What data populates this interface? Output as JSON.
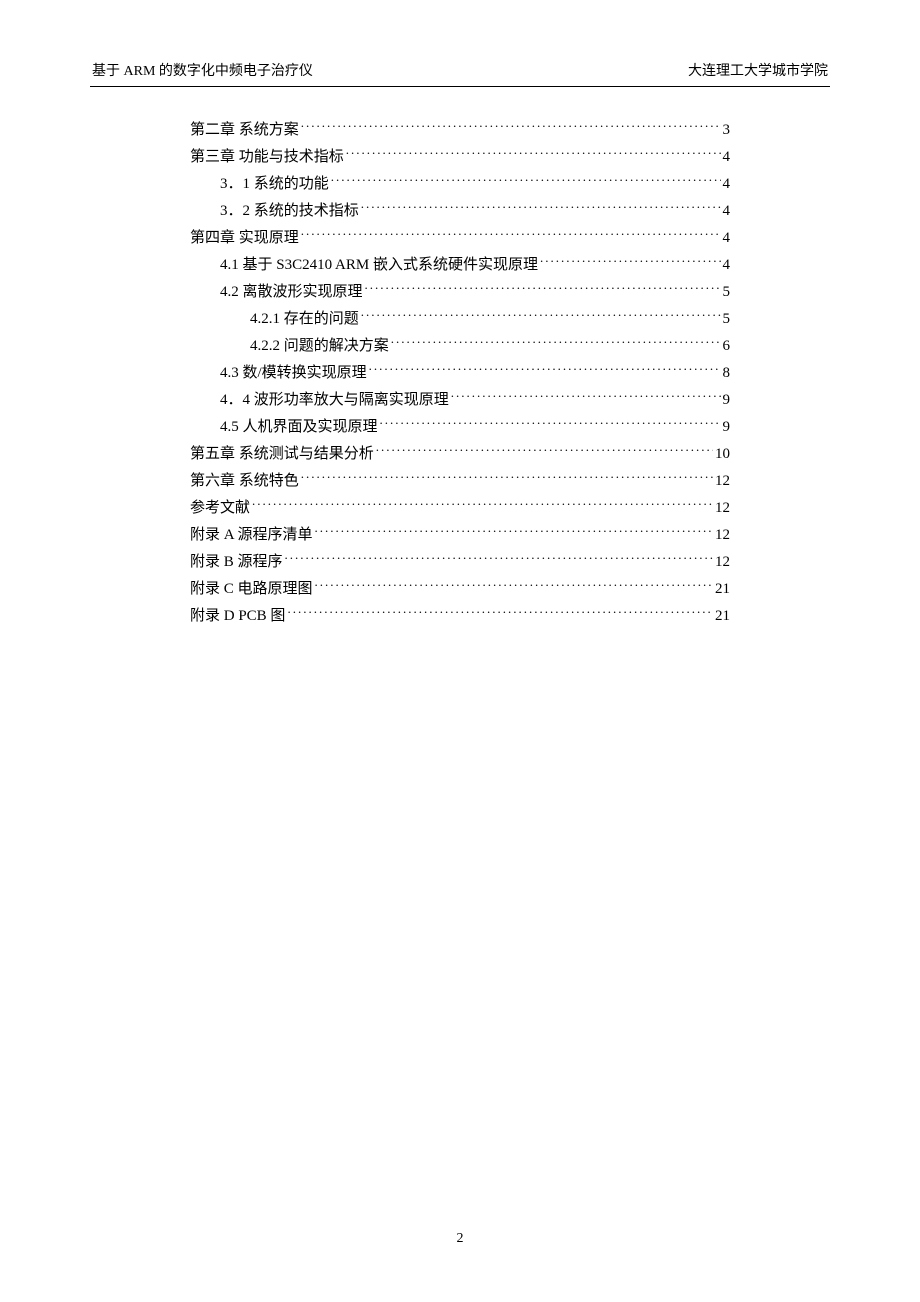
{
  "header": {
    "left": "基于 ARM 的数字化中频电子治疗仪",
    "right": "大连理工大学城市学院"
  },
  "toc": [
    {
      "label": "第二章  系统方案",
      "page": "3",
      "indent": 0
    },
    {
      "label": "第三章  功能与技术指标",
      "page": "4",
      "indent": 0
    },
    {
      "label": "3．1  系统的功能",
      "page": "4",
      "indent": 1
    },
    {
      "label": "3．2  系统的技术指标",
      "page": "4",
      "indent": 1
    },
    {
      "label": "第四章  实现原理",
      "page": "4",
      "indent": 0
    },
    {
      "label": "4.1  基于 S3C2410 ARM 嵌入式系统硬件实现原理",
      "page": "4",
      "indent": 1
    },
    {
      "label": "4.2  离散波形实现原理",
      "page": "5",
      "indent": 1
    },
    {
      "label": "4.2.1 存在的问题",
      "page": "5",
      "indent": 2
    },
    {
      "label": "4.2.2  问题的解决方案",
      "page": "6",
      "indent": 2
    },
    {
      "label": "4.3  数/模转换实现原理 ",
      "page": "8",
      "indent": 1
    },
    {
      "label": "4．4  波形功率放大与隔离实现原理",
      "page": "9",
      "indent": 1
    },
    {
      "label": "4.5  人机界面及实现原理",
      "page": "9",
      "indent": 1
    },
    {
      "label": "第五章  系统测试与结果分析",
      "page": "10",
      "indent": 0
    },
    {
      "label": "第六章  系统特色",
      "page": "12",
      "indent": 0
    },
    {
      "label": "参考文献",
      "page": "12",
      "indent": 0
    },
    {
      "label": "附录  A  源程序清单",
      "page": "12",
      "indent": 0
    },
    {
      "label": "附录  B     源程序",
      "page": "12",
      "indent": 0
    },
    {
      "label": "附录  C  电路原理图",
      "page": "21",
      "indent": 0
    },
    {
      "label": "附录  D    PCB 图",
      "page": "21",
      "indent": 0
    }
  ],
  "footer": {
    "page_number": "2"
  }
}
